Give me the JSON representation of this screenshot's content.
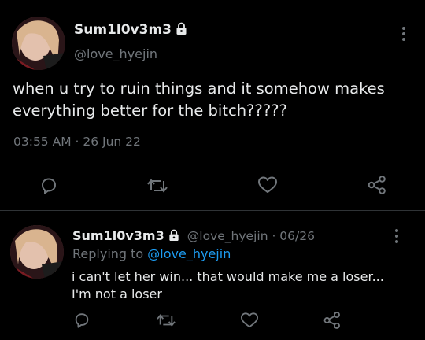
{
  "main_tweet": {
    "display_name": "Sum1l0v3m3",
    "handle": "@love_hyejin",
    "text": "when u try to ruin things and it somehow makes everything better for the bitch?????",
    "timestamp": "03:55 AM · 26 Jun 22",
    "icons": {
      "lock": "lock-icon",
      "more": "more-vertical-icon",
      "reply": "reply-icon",
      "retweet": "retweet-icon",
      "like": "heart-icon",
      "share": "share-icon"
    }
  },
  "reply_tweet": {
    "display_name": "Sum1l0v3m3",
    "handle": "@love_hyejin",
    "date": "06/26",
    "replying_prefix": "Replying to",
    "replying_to": "@love_hyejin",
    "text_line1": "i can't let her win... that would make me a loser...",
    "text_line2": "I'm not a loser"
  },
  "colors": {
    "background": "#000000",
    "text": "#e7e9ea",
    "secondary": "#71767b",
    "link": "#1d9bf0",
    "divider": "#2f3336"
  }
}
